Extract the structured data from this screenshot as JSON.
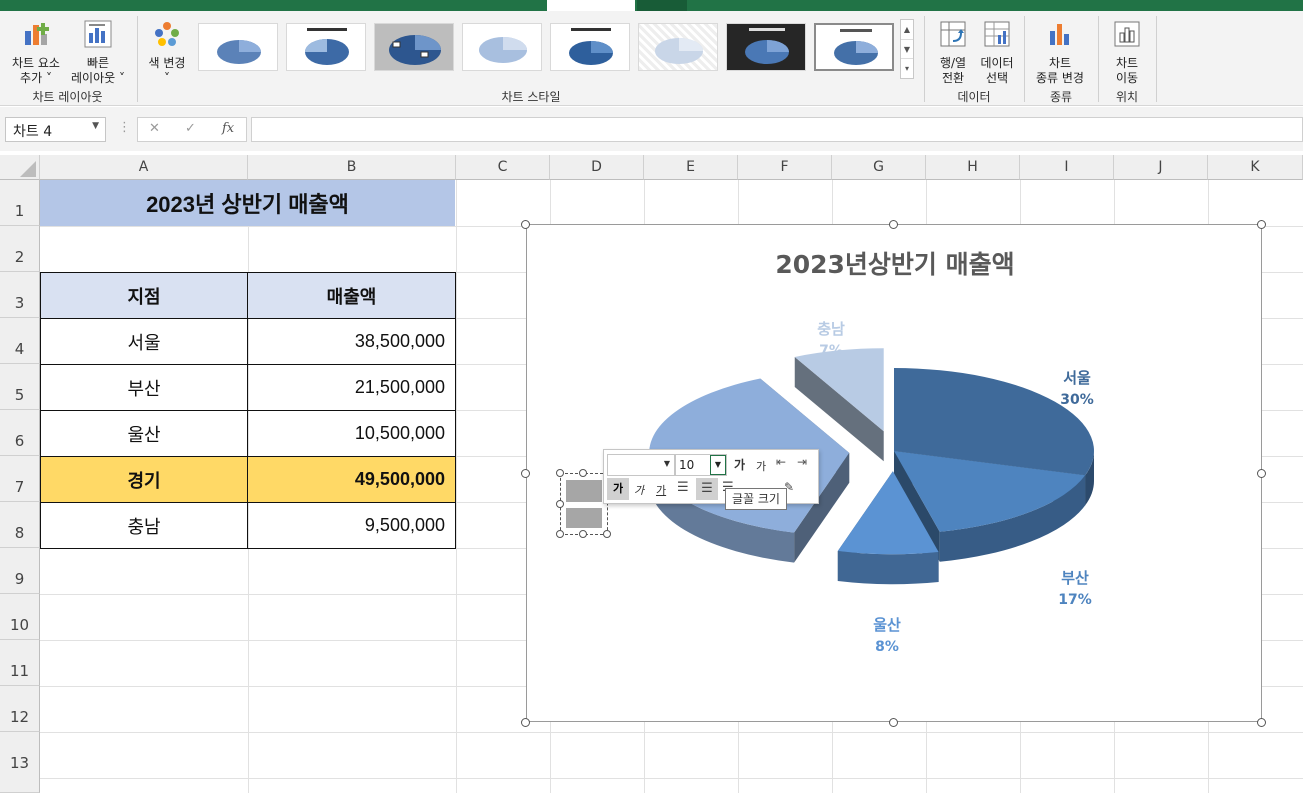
{
  "ribbon": {
    "add_element": "차트 요소\n추가 ˅",
    "quick_layout": "빠른\n레이아웃 ˅",
    "group_layout": "차트 레이아웃",
    "change_color": "색 변경\n˅",
    "group_styles": "차트 스타일",
    "switch_row_col": "행/열\n전환",
    "select_data": "데이터\n선택",
    "group_data": "데이터",
    "change_type": "차트\n종류 변경",
    "group_type": "종류",
    "move_chart": "차트\n이동",
    "group_location": "위치",
    "thumb_title_1": "2023년상반기 매출액"
  },
  "formula_bar": {
    "name_box": "차트 4",
    "fx": "fx"
  },
  "columns": [
    "A",
    "B",
    "C",
    "D",
    "E",
    "F",
    "G",
    "H",
    "I",
    "J",
    "K"
  ],
  "rows": [
    "1",
    "2",
    "3",
    "4",
    "5",
    "6",
    "7",
    "8",
    "9",
    "10",
    "11",
    "12",
    "13"
  ],
  "sheet": {
    "title": "2023년 상반기 매출액",
    "header_branch": "지점",
    "header_sales": "매출액",
    "data": [
      {
        "branch": "서울",
        "sales": "38,500,000"
      },
      {
        "branch": "부산",
        "sales": "21,500,000"
      },
      {
        "branch": "울산",
        "sales": "10,500,000"
      },
      {
        "branch": "경기",
        "sales": "49,500,000"
      },
      {
        "branch": "충남",
        "sales": "9,500,000"
      }
    ]
  },
  "colors": {
    "title_fill": "#b4c6e7",
    "header_fill": "#d9e1f2",
    "highlight_fill": "#ffd966",
    "excel_green": "#217346"
  },
  "mini_toolbar": {
    "font_size": "10",
    "tooltip": "글꼴 크기"
  },
  "chart_data": {
    "type": "pie",
    "title": "2023년상반기 매출액",
    "categories": [
      "서울",
      "부산",
      "울산",
      "경기",
      "충남"
    ],
    "values": [
      38500000,
      21500000,
      10500000,
      49500000,
      9500000
    ],
    "labels_pct": [
      "30%",
      "17%",
      "8%",
      "",
      "7%"
    ],
    "colors": [
      "#3f6a9a",
      "#4e84bf",
      "#5b93d3",
      "#8eaedb",
      "#b8cbe4"
    ]
  }
}
